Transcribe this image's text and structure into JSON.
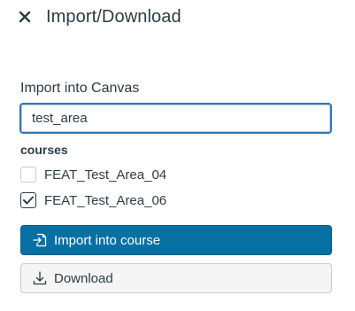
{
  "tray": {
    "title": "Import/Download",
    "close_icon": "close-icon"
  },
  "import_section": {
    "label": "Import into Canvas",
    "search_value": "test_area",
    "search_placeholder": ""
  },
  "courses": {
    "label": "courses",
    "items": [
      {
        "name": "FEAT_Test_Area_04",
        "checked": false
      },
      {
        "name": "FEAT_Test_Area_06",
        "checked": true
      }
    ]
  },
  "actions": {
    "import_label": "Import into course",
    "import_icon": "import-icon",
    "download_label": "Download",
    "download_icon": "download-icon"
  },
  "colors": {
    "primary": "#0770a3",
    "text": "#2d3b45",
    "focus_border": "#2b7abc"
  }
}
